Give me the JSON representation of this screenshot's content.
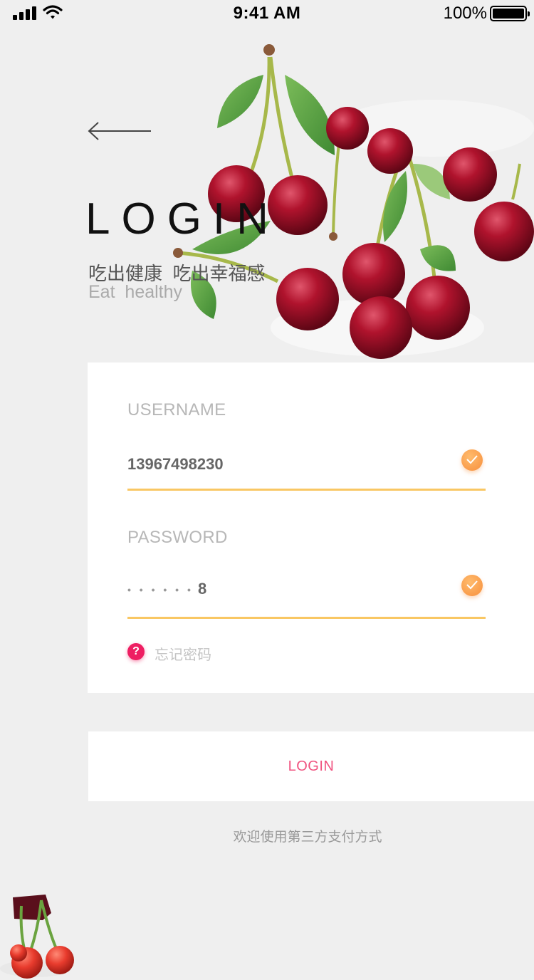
{
  "status_bar": {
    "time": "9:41 AM",
    "battery_percent": "100%",
    "signal_icon": "signal-bars-icon",
    "wifi_icon": "wifi-icon",
    "battery_icon": "battery-full-icon"
  },
  "header": {
    "back_icon": "arrow-left-icon",
    "title": "LOGIN",
    "subtitle_cn": "吃出健康  吃出幸福感",
    "subtitle_en": "Eat  healthy"
  },
  "form": {
    "username_label": "USERNAME",
    "username_value": "13967498230",
    "password_label": "PASSWORD",
    "password_masked": "• • • • • •",
    "password_last_char": "8",
    "forgot_icon_glyph": "?",
    "forgot_label": "忘记密码"
  },
  "actions": {
    "login_label": "LOGIN",
    "third_party_text": "欢迎使用第三方支付方式"
  },
  "colors": {
    "background": "#efefef",
    "accent_line": "#f9c763",
    "check_orange": "#f78f3c",
    "login_pink": "#f0527f",
    "forgot_red": "#ee1e62"
  }
}
